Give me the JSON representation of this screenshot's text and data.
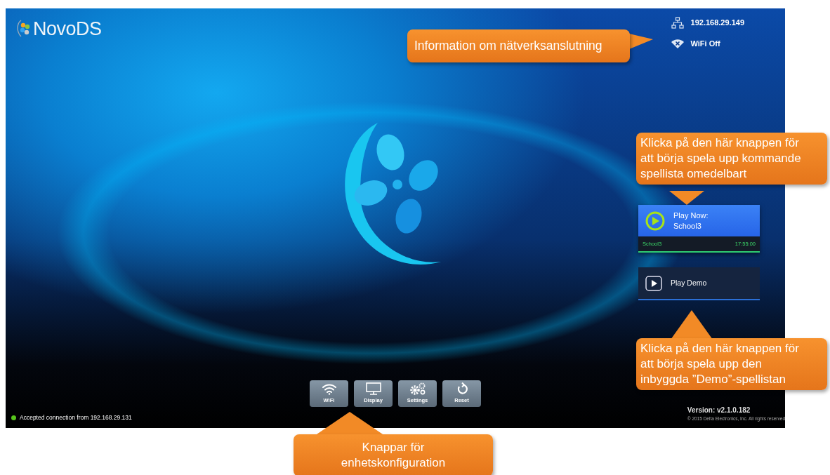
{
  "screen": {
    "logo": "**Novo**DS",
    "network": {
      "ip": "192.168.29.149",
      "wifi": "WiFi Off",
      "wifi_on": false
    },
    "play_now": {
      "label": "Play Now:",
      "playlist": "School3",
      "schedule_name": "School3",
      "schedule_time": "17:55:00"
    },
    "play_demo": {
      "label": "Play Demo"
    },
    "toolbar": [
      {
        "label": "WiFi",
        "kind": "wifi"
      },
      {
        "label": "Display",
        "kind": "display"
      },
      {
        "label": "Settings",
        "kind": "settings"
      },
      {
        "label": "Reset",
        "kind": "reset"
      }
    ],
    "status": {
      "text": "Accepted connection from 192.168.29.131",
      "connected": true
    },
    "version": "Version:  v2.1.0.182",
    "copyright": "© 2015 Delta Electronics, Inc. All rights reserved"
  },
  "callouts": [
    {
      "text": "Information om nätverksanslutning",
      "kind": "right"
    },
    {
      "text": "Klicka på den här knappen för att börja spela upp kommande spellista omedelbart",
      "kind": "down"
    },
    {
      "text": "Klicka på den här knappen för att börja spela upp den inbyggda ”Demo”-spellistan",
      "kind": "up"
    },
    {
      "text": "Knappar för enhetskonfiguration",
      "kind": "up"
    }
  ]
}
